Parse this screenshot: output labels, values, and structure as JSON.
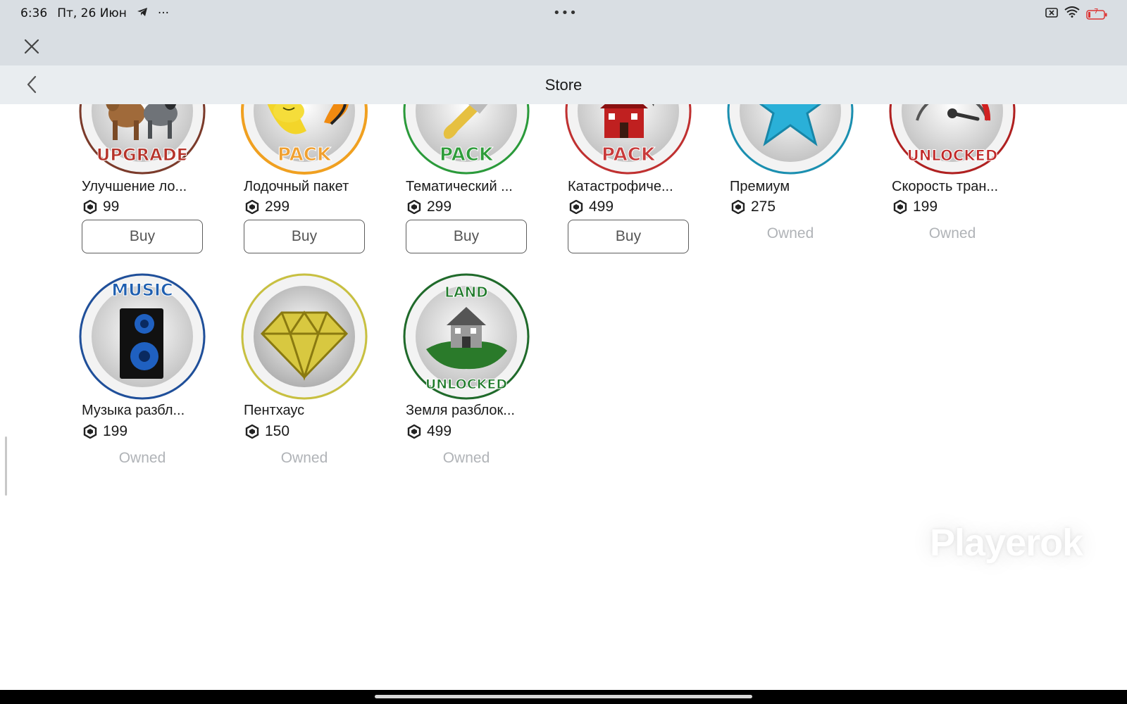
{
  "status_bar": {
    "time": "6:36",
    "date": "Пт, 26 Июн",
    "overflow": "···",
    "center_dots": "•••",
    "battery": "7"
  },
  "nav": {
    "title": "Store"
  },
  "items": [
    {
      "name": "Улучшение ло...",
      "price": "99",
      "action": "Buy",
      "badge_text": "UPGRADE",
      "ring_color": "#7b3a2a",
      "label_color": "#b5332a"
    },
    {
      "name": "Лодочный пакет",
      "price": "299",
      "action": "Buy",
      "badge_text": "PACK",
      "ring_color": "#f0a020",
      "label_color": "#f0a030"
    },
    {
      "name": "Тематический ...",
      "price": "299",
      "action": "Buy",
      "badge_text": "PACK",
      "ring_color": "#2a9a3a",
      "label_color": "#2e9c3a"
    },
    {
      "name": "Катастрофиче...",
      "price": "499",
      "action": "Buy",
      "badge_text": "PACK",
      "ring_color": "#c03030",
      "label_color": "#c83a3a"
    },
    {
      "name": "Премиум",
      "price": "275",
      "action": "Owned",
      "badge_text": "",
      "ring_color": "#1a8fb0",
      "label_color": "#2ab0d8"
    },
    {
      "name": "Скорость тран...",
      "price": "199",
      "action": "Owned",
      "badge_text": "UNLOCKED",
      "ring_color": "#b02020",
      "label_color": "#c02828"
    },
    {
      "name": "Музыка разбл...",
      "price": "199",
      "action": "Owned",
      "badge_text": "MUSIC",
      "ring_color": "#1f4f9a",
      "label_color": "#1f5fb0"
    },
    {
      "name": "Пентхаус",
      "price": "150",
      "action": "Owned",
      "badge_text": "",
      "ring_color": "#c8c040",
      "label_color": "#d8c840"
    },
    {
      "name": "Земля разблок...",
      "price": "499",
      "action": "Owned",
      "badge_text": "LAND UNLOCKED",
      "ring_color": "#1f6a2a",
      "label_color": "#1f7a2a"
    }
  ],
  "watermark": "Playerok",
  "icons": {
    "close": "close-icon",
    "back": "chevron-left-icon",
    "currency": "robux-icon"
  }
}
